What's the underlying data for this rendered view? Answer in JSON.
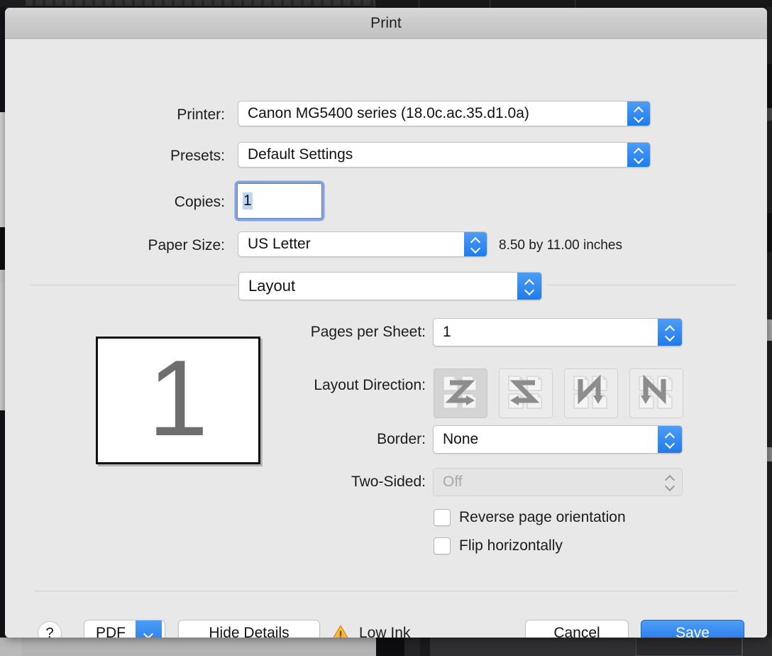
{
  "window": {
    "title": "Print"
  },
  "fields": {
    "printer": {
      "label": "Printer:",
      "value": "Canon MG5400 series (18.0c.ac.35.d1.0a)"
    },
    "presets": {
      "label": "Presets:",
      "value": "Default Settings"
    },
    "copies": {
      "label": "Copies:",
      "value": "1"
    },
    "paper_size": {
      "label": "Paper Size:",
      "value": "US Letter",
      "note": "8.50 by 11.00 inches"
    },
    "pane": {
      "value": "Layout"
    },
    "pages_per_sheet": {
      "label": "Pages per Sheet:",
      "value": "1"
    },
    "layout_direction": {
      "label": "Layout Direction:",
      "options": [
        {
          "name": "across-then-down-right",
          "selected": true
        },
        {
          "name": "across-then-down-left",
          "selected": false
        },
        {
          "name": "down-then-across-right",
          "selected": false
        },
        {
          "name": "down-then-across-left",
          "selected": false
        }
      ]
    },
    "border": {
      "label": "Border:",
      "value": "None"
    },
    "two_sided": {
      "label": "Two-Sided:",
      "value": "Off",
      "disabled": true
    },
    "reverse_page_orientation": {
      "label": "Reverse page orientation",
      "checked": false
    },
    "flip_horizontally": {
      "label": "Flip horizontally",
      "checked": false
    }
  },
  "preview": {
    "page_number": "1"
  },
  "footer": {
    "help_label": "?",
    "pdf_label": "PDF",
    "hide_details_label": "Hide Details",
    "status_label": "Low Ink",
    "cancel_label": "Cancel",
    "save_label": "Save"
  },
  "colors": {
    "accent_blue": "#1f7ced",
    "sheet_background": "#e8e8e8",
    "titlebar": "#c9c9c9",
    "warning_yellow": "#e8a317",
    "selection_blue": "#bcd5f5",
    "preview_digit": "#6e6e6e"
  }
}
